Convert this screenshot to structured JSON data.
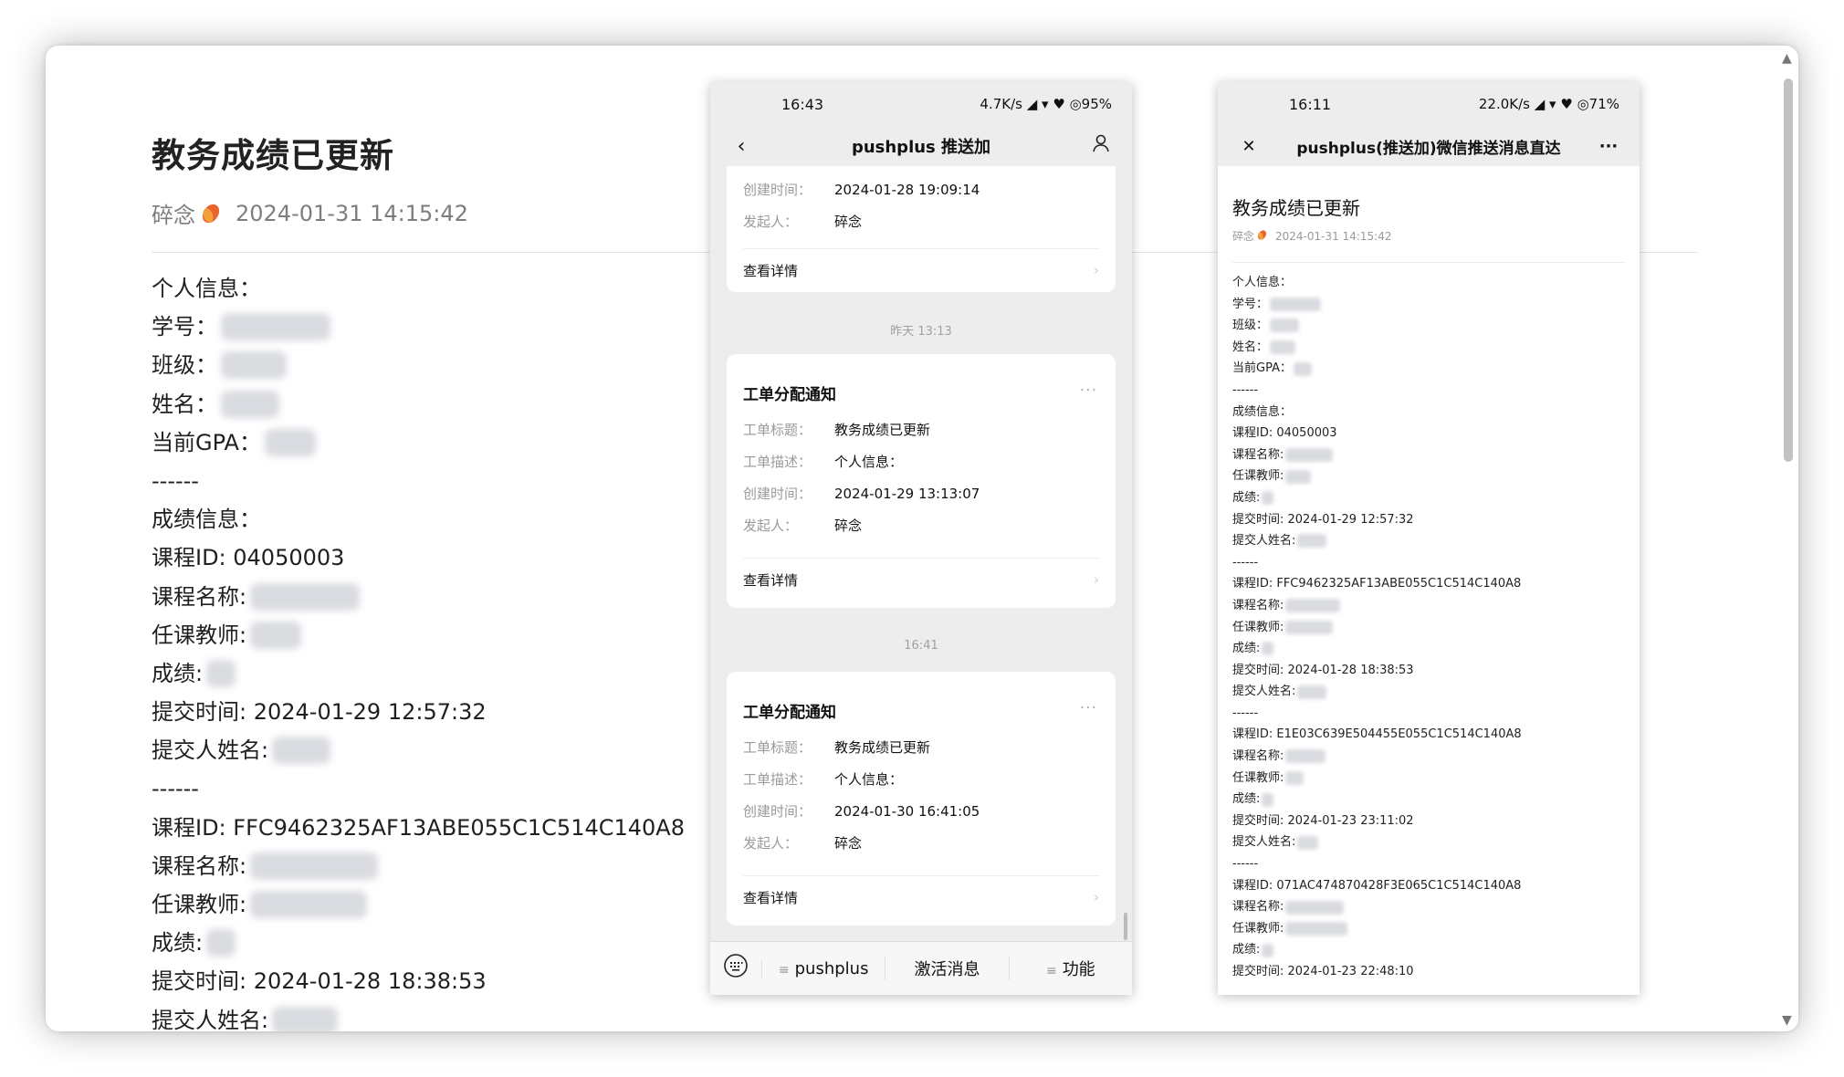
{
  "article": {
    "title": "教务成绩已更新",
    "author": "碎念",
    "datetime": "2024-01-31 14:15:42",
    "lines": [
      {
        "text": "个人信息：",
        "blur": 0
      },
      {
        "text": "学号：",
        "blur": 150
      },
      {
        "text": "班级：",
        "blur": 90
      },
      {
        "text": "姓名：",
        "blur": 80
      },
      {
        "text": "当前GPA：",
        "blur": 70
      },
      {
        "text": "------",
        "blur": 0
      },
      {
        "text": "成绩信息：",
        "blur": 0
      },
      {
        "text": "课程ID: 04050003",
        "blur": 0
      },
      {
        "text": "课程名称:",
        "blur": 150
      },
      {
        "text": "任课教师:",
        "blur": 70
      },
      {
        "text": "成绩:",
        "blur": 40
      },
      {
        "text": "提交时间: 2024-01-29 12:57:32",
        "blur": 0
      },
      {
        "text": "提交人姓名:",
        "blur": 80
      },
      {
        "text": "------",
        "blur": 0
      },
      {
        "text": "课程ID: FFC9462325AF13ABE055C1C514C140A8",
        "blur": 0
      },
      {
        "text": "课程名称:",
        "blur": 175
      },
      {
        "text": "任课教师:",
        "blur": 160
      },
      {
        "text": "成绩:",
        "blur": 40
      },
      {
        "text": "提交时间: 2024-01-28 18:38:53",
        "blur": 0
      },
      {
        "text": "提交人姓名:",
        "blur": 90
      }
    ]
  },
  "phone1": {
    "status_time": "16:43",
    "status_right": "4.7K/s ◢ ▾ ♥ ◎95%",
    "nav_title": "pushplus 推送加",
    "back_icon": "‹",
    "user_icon": "person-icon",
    "card0": {
      "rows": [
        {
          "k": "创建时间：",
          "v": "2024-01-28 19:09:14"
        },
        {
          "k": "发起人：",
          "v": "碎念"
        }
      ],
      "detail": "查看详情"
    },
    "ts1": "昨天 13:13",
    "card1": {
      "title": "工单分配通知",
      "more": "···",
      "rows": [
        {
          "k": "工单标题：",
          "v": "教务成绩已更新"
        },
        {
          "k": "工单描述：",
          "v": "个人信息："
        },
        {
          "k": "创建时间：",
          "v": "2024-01-29 13:13:07"
        },
        {
          "k": "发起人：",
          "v": "碎念"
        }
      ],
      "detail": "查看详情"
    },
    "ts2": "16:41",
    "card2": {
      "title": "工单分配通知",
      "more": "···",
      "rows": [
        {
          "k": "工单标题：",
          "v": "教务成绩已更新"
        },
        {
          "k": "工单描述：",
          "v": "个人信息："
        },
        {
          "k": "创建时间：",
          "v": "2024-01-30 16:41:05"
        },
        {
          "k": "发起人：",
          "v": "碎念"
        }
      ],
      "detail": "查看详情"
    },
    "bottom": {
      "tab1": "pushplus",
      "tab2": "激活消息",
      "tab3": "功能"
    }
  },
  "phone2": {
    "status_time": "16:11",
    "status_right": "22.0K/s ◢ ▾ ♥ ◎71%",
    "nav_title": "pushplus(推送加)微信推送消息直达",
    "close_icon": "✕",
    "more_icon": "···",
    "title": "教务成绩已更新",
    "author": "碎念",
    "datetime": "2024-01-31 14:15:42",
    "lines": [
      {
        "text": "个人信息：",
        "blur": 0
      },
      {
        "text": "学号：",
        "blur": 70
      },
      {
        "text": "班级：",
        "blur": 40
      },
      {
        "text": "姓名：",
        "blur": 35
      },
      {
        "text": "当前GPA：",
        "blur": 25
      },
      {
        "text": "------",
        "blur": 0
      },
      {
        "text": "成绩信息：",
        "blur": 0
      },
      {
        "text": "课程ID: 04050003",
        "blur": 0
      },
      {
        "text": "课程名称:",
        "blur": 65
      },
      {
        "text": "任课教师:",
        "blur": 35
      },
      {
        "text": "成绩:",
        "blur": 16
      },
      {
        "text": "提交时间: 2024-01-29 12:57:32",
        "blur": 0
      },
      {
        "text": "提交人姓名:",
        "blur": 40
      },
      {
        "text": "------",
        "blur": 0
      },
      {
        "text": "课程ID: FFC9462325AF13ABE055C1C514C140A8",
        "blur": 0
      },
      {
        "text": "课程名称:",
        "blur": 75
      },
      {
        "text": "任课教师:",
        "blur": 65
      },
      {
        "text": "成绩:",
        "blur": 16
      },
      {
        "text": "提交时间: 2024-01-28 18:38:53",
        "blur": 0
      },
      {
        "text": "提交人姓名:",
        "blur": 40
      },
      {
        "text": "------",
        "blur": 0
      },
      {
        "text": "课程ID: E1E03C639E504455E055C1C514C140A8",
        "blur": 0
      },
      {
        "text": "课程名称:",
        "blur": 55
      },
      {
        "text": "任课教师:",
        "blur": 25
      },
      {
        "text": "成绩:",
        "blur": 16
      },
      {
        "text": "提交时间: 2024-01-23 23:11:02",
        "blur": 0
      },
      {
        "text": "提交人姓名:",
        "blur": 28
      },
      {
        "text": "------",
        "blur": 0
      },
      {
        "text": "课程ID: 071AC474870428F3E065C1C514C140A8",
        "blur": 0
      },
      {
        "text": "课程名称:",
        "blur": 80
      },
      {
        "text": "任课教师:",
        "blur": 85
      },
      {
        "text": "成绩:",
        "blur": 16
      },
      {
        "text": "提交时间: 2024-01-23 22:48:10",
        "blur": 0
      }
    ]
  }
}
